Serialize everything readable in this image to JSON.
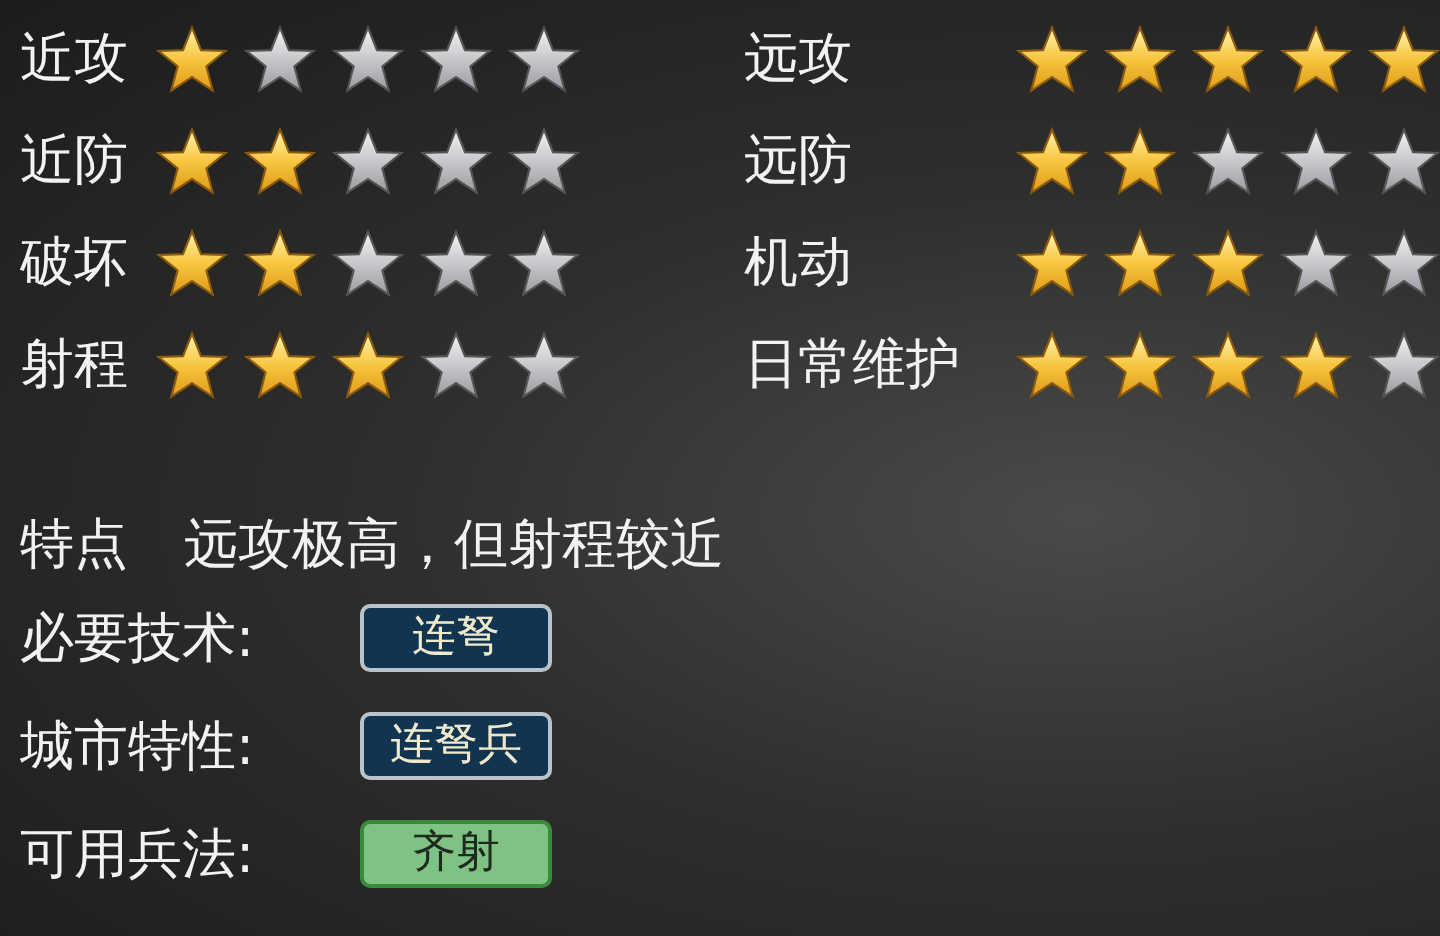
{
  "ratings": [
    {
      "label": "近攻",
      "stars": 1
    },
    {
      "label": "远攻",
      "stars": 5
    },
    {
      "label": "近防",
      "stars": 2
    },
    {
      "label": "远防",
      "stars": 2
    },
    {
      "label": "破坏",
      "stars": 2
    },
    {
      "label": "机动",
      "stars": 3
    },
    {
      "label": "射程",
      "stars": 3
    },
    {
      "label": "日常维护",
      "stars": 4
    }
  ],
  "feature": {
    "label": "特点",
    "text": "远攻极高，但射程较近"
  },
  "requirements": [
    {
      "label": "必要技术:",
      "value": "连弩",
      "kind": "tech"
    },
    {
      "label": "城市特性:",
      "value": "连弩兵",
      "kind": "tech"
    },
    {
      "label": "可用兵法:",
      "value": "齐射",
      "kind": "tactic"
    }
  ]
}
